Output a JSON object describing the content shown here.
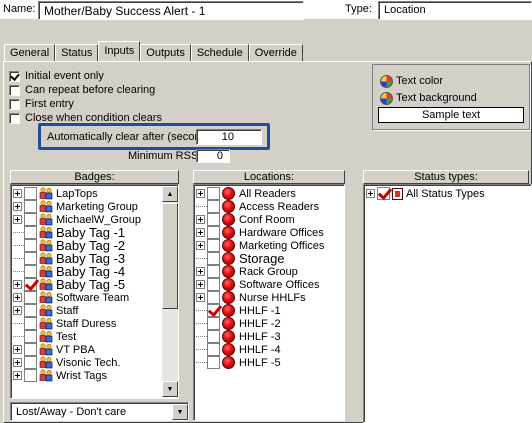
{
  "header": {
    "name_label": "Name:",
    "name_value": "Mother/Baby Success Alert - 1",
    "type_label": "Type:",
    "type_value": "Location"
  },
  "tabs": [
    {
      "label": "General"
    },
    {
      "label": "Status"
    },
    {
      "label": "Inputs"
    },
    {
      "label": "Outputs"
    },
    {
      "label": "Schedule"
    },
    {
      "label": "Override"
    }
  ],
  "active_tab": "Inputs",
  "options": {
    "initial_event_only": {
      "label": "Initial event only",
      "checked": true
    },
    "can_repeat": {
      "label": "Can repeat before clearing",
      "checked": false
    },
    "first_entry": {
      "label": "First entry",
      "checked": false
    },
    "close_when_clears": {
      "label": "Close when condition clears",
      "checked": false
    },
    "auto_clear_label": "Automatically clear after (seconds):",
    "auto_clear_value": "10",
    "min_rssi_label": "Minimum RSSI:",
    "min_rssi_value": "0"
  },
  "appearance": {
    "text_color_label": "Text color",
    "text_background_label": "Text background",
    "sample_text": "Sample text"
  },
  "badges": {
    "header": "Badges:",
    "items": [
      {
        "label": "LapTops",
        "expand": true,
        "checked": false,
        "large": false
      },
      {
        "label": "Marketing Group",
        "expand": true,
        "checked": false,
        "large": false
      },
      {
        "label": "MichaelW_Group",
        "expand": true,
        "checked": false,
        "large": false
      },
      {
        "label": "Baby Tag -1",
        "expand": false,
        "checked": false,
        "large": true
      },
      {
        "label": "Baby Tag -2",
        "expand": false,
        "checked": false,
        "large": true
      },
      {
        "label": "Baby Tag -3",
        "expand": false,
        "checked": false,
        "large": true
      },
      {
        "label": "Baby Tag -4",
        "expand": false,
        "checked": false,
        "large": true
      },
      {
        "label": "Baby Tag -5",
        "expand": true,
        "checked": true,
        "large": true
      },
      {
        "label": "Software Team",
        "expand": true,
        "checked": false,
        "large": false
      },
      {
        "label": "Staff",
        "expand": true,
        "checked": false,
        "large": false
      },
      {
        "label": "Staff Duress",
        "expand": false,
        "checked": false,
        "large": false
      },
      {
        "label": "Test",
        "expand": false,
        "checked": false,
        "large": false
      },
      {
        "label": "VT PBA",
        "expand": true,
        "checked": false,
        "large": false
      },
      {
        "label": "Visonic Tech.",
        "expand": true,
        "checked": false,
        "large": false
      },
      {
        "label": "Wrist Tags",
        "expand": true,
        "checked": false,
        "large": false
      }
    ],
    "dropdown_value": "Lost/Away - Don't care"
  },
  "locations": {
    "header": "Locations:",
    "items": [
      {
        "label": "All Readers",
        "expand": true,
        "checked": false,
        "large": false
      },
      {
        "label": "Access Readers",
        "expand": false,
        "checked": false,
        "large": false
      },
      {
        "label": "Conf Room",
        "expand": true,
        "checked": false,
        "large": false
      },
      {
        "label": "Hardware Offices",
        "expand": true,
        "checked": false,
        "large": false
      },
      {
        "label": "Marketing Offices",
        "expand": true,
        "checked": false,
        "large": false
      },
      {
        "label": "Storage",
        "expand": false,
        "checked": false,
        "large": true
      },
      {
        "label": "Rack Group",
        "expand": true,
        "checked": false,
        "large": false
      },
      {
        "label": "Software Offices",
        "expand": true,
        "checked": false,
        "large": false
      },
      {
        "label": "Nurse HHLFs",
        "expand": true,
        "checked": false,
        "large": false
      },
      {
        "label": "HHLF -1",
        "expand": false,
        "checked": true,
        "large": false
      },
      {
        "label": "HHLF -2",
        "expand": false,
        "checked": false,
        "large": false
      },
      {
        "label": "HHLF -3",
        "expand": false,
        "checked": false,
        "large": false
      },
      {
        "label": "HHLF -4",
        "expand": false,
        "checked": false,
        "large": false
      },
      {
        "label": "HHLF -5",
        "expand": false,
        "checked": false,
        "large": false
      }
    ]
  },
  "status_types": {
    "header": "Status types:",
    "items": [
      {
        "label": "All Status Types",
        "expand": true,
        "checked": true
      }
    ]
  },
  "colors": {
    "highlight": "#1f4e99",
    "check": "#cc0000"
  },
  "icons": {
    "badge": "badge-people-icon",
    "location": "location-red-dot-icon",
    "status": "status-type-icon",
    "color": "color-palette-icon"
  }
}
